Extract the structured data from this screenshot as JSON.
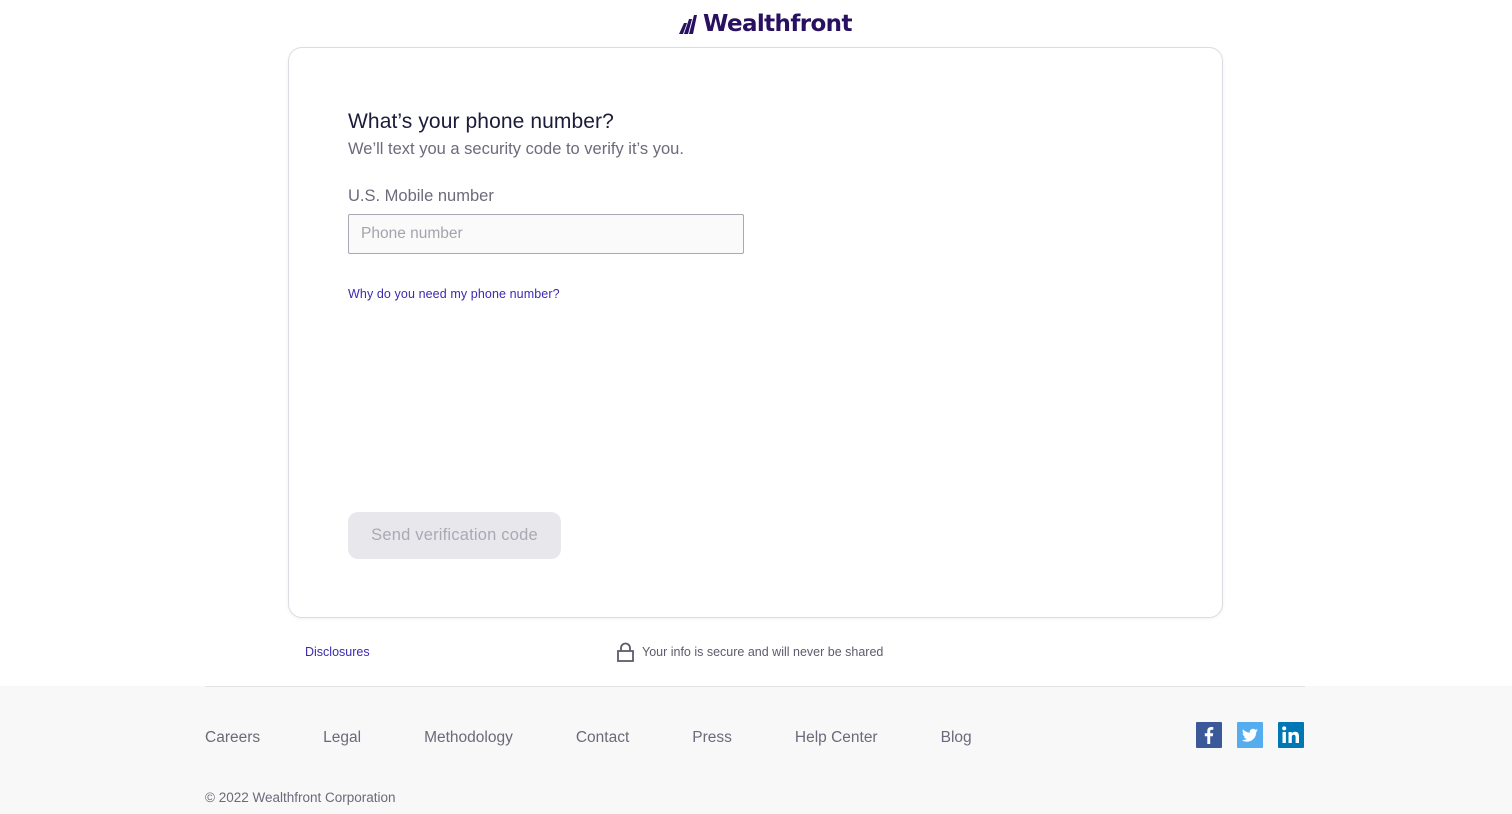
{
  "brand": {
    "name": "Wealthfront",
    "color": "#2a1060"
  },
  "form": {
    "title": "What’s your phone number?",
    "subtitle": "We’ll text you a security code to verify it’s you.",
    "phone_label": "U.S. Mobile number",
    "phone_placeholder": "Phone number",
    "phone_value": "",
    "why_link": "Why do you need my phone number?",
    "submit_label": "Send verification code",
    "submit_state": "disabled"
  },
  "below_card": {
    "disclosures_link": "Disclosures",
    "secure_text": "Your info is secure and will never be shared",
    "secure_icon": "lock-icon"
  },
  "footer": {
    "links": [
      "Careers",
      "Legal",
      "Methodology",
      "Contact",
      "Press",
      "Help Center",
      "Blog"
    ],
    "social": [
      {
        "name": "facebook-icon",
        "color": "#3b5998"
      },
      {
        "name": "twitter-icon",
        "color": "#55acee"
      },
      {
        "name": "linkedin-icon",
        "color": "#0077b5"
      }
    ],
    "copyright": "© 2022 Wealthfront Corporation"
  },
  "colors": {
    "link": "#3b2ab0",
    "disabled_button_bg": "#e8e8ec",
    "disabled_button_text": "#a9a9b6"
  }
}
